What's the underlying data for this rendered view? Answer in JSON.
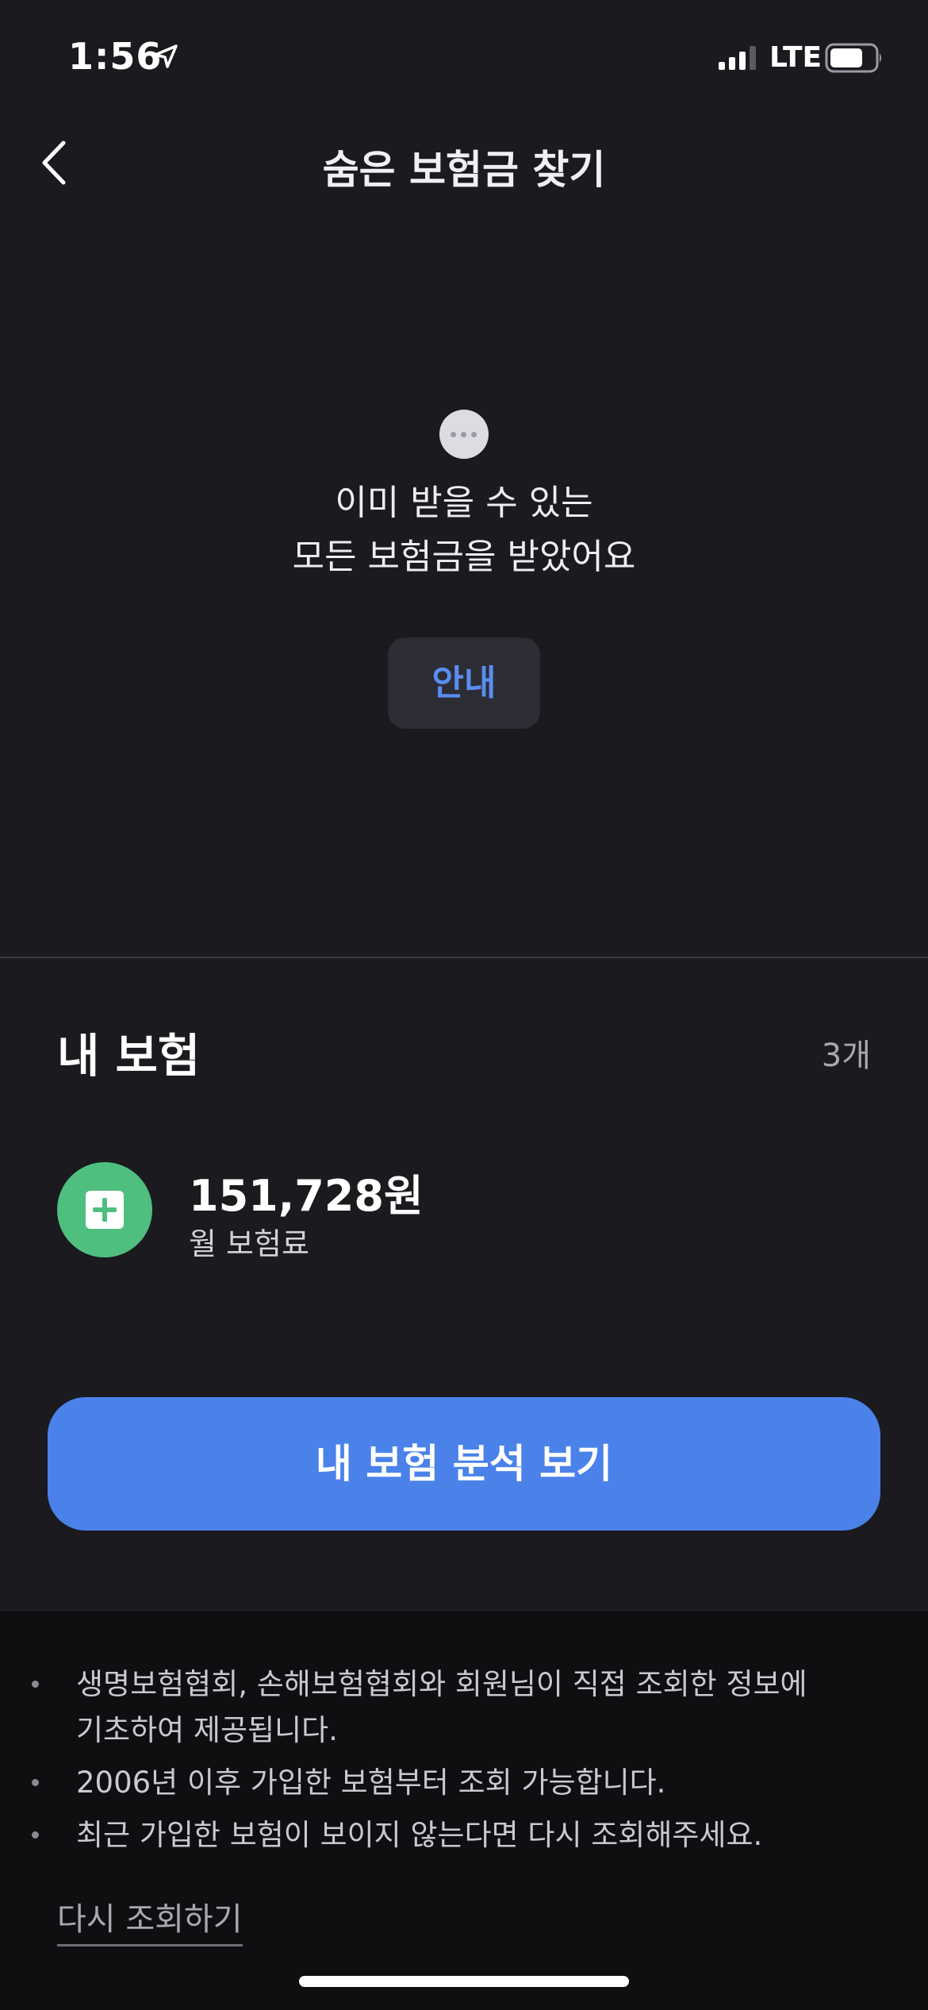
{
  "status_bar": {
    "time": "1:56",
    "network": "LTE",
    "signal_icon": "cellular-signal",
    "battery_icon": "battery",
    "location_icon": "location-arrow"
  },
  "header": {
    "title": "숨은 보험금 찾기",
    "back_icon": "chevron-left"
  },
  "empty_state": {
    "icon": "ellipsis-circle",
    "message_line1": "이미 받을 수 있는",
    "message_line2": "모든 보험금을 받았어요",
    "info_button_label": "안내"
  },
  "my_insurance": {
    "title": "내 보험",
    "count": "3개",
    "premium_amount": "151,728원",
    "premium_label": "월 보험료",
    "icon": "medical-plus",
    "icon_color": "#4fbf7f",
    "analysis_button_label": "내 보험 분석 보기"
  },
  "notes": {
    "items": [
      "생명보험협회, 손해보험협회와 회원님이 직접 조회한 정보에 기초하여 제공됩니다.",
      "2006년 이후 가입한 보험부터 조회 가능합니다.",
      "최근 가입한 보험이 보이지 않는다면 다시 조회해주세요."
    ],
    "retry_link_label": "다시 조회하기"
  },
  "colors": {
    "accent": "#4a82ea",
    "info_text": "#5a8df0",
    "background": "#1a1a1f",
    "footer_background": "#0f0f12"
  }
}
